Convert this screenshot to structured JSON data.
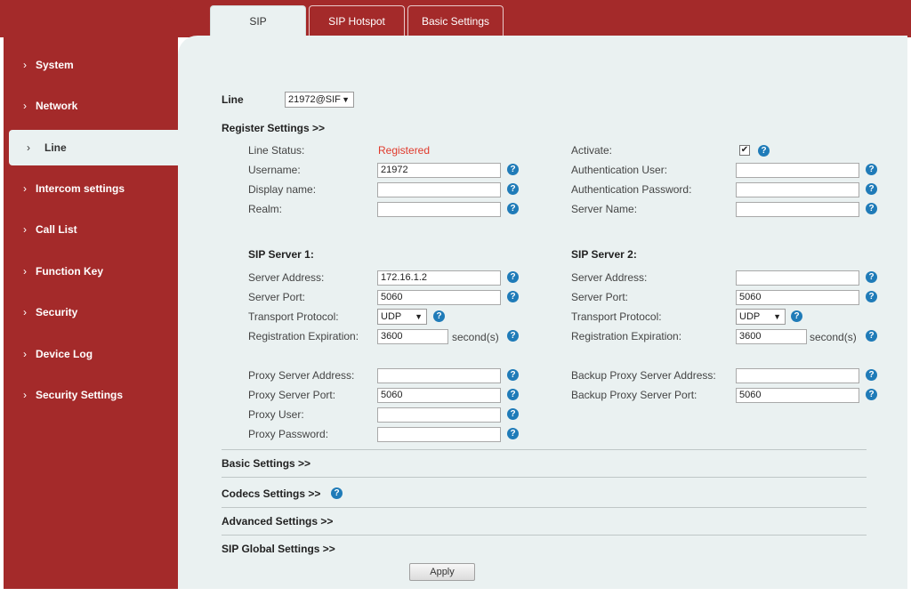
{
  "sidebar": {
    "items": [
      {
        "label": "System"
      },
      {
        "label": "Network"
      },
      {
        "label": "Line"
      },
      {
        "label": "Intercom settings"
      },
      {
        "label": "Call List"
      },
      {
        "label": "Function Key"
      },
      {
        "label": "Security"
      },
      {
        "label": "Device Log"
      },
      {
        "label": "Security Settings"
      }
    ],
    "active": "Line",
    "chevron": "›"
  },
  "tabs": [
    {
      "label": "SIP",
      "active": true
    },
    {
      "label": "SIP Hotspot",
      "active": false
    },
    {
      "label": "Basic Settings",
      "active": false
    }
  ],
  "line_selector": {
    "label": "Line",
    "value": "21972@SIF"
  },
  "sections": {
    "register": "Register Settings >>",
    "basic": "Basic Settings >>",
    "codecs": "Codecs Settings >>",
    "advanced": "Advanced Settings >>",
    "sip_global": "SIP Global Settings >>"
  },
  "register": {
    "line_status_label": "Line Status:",
    "line_status_value": "Registered",
    "activate_label": "Activate:",
    "activate_checked": "✔",
    "username_label": "Username:",
    "username_value": "21972",
    "auth_user_label": "Authentication User:",
    "auth_user_value": "",
    "display_name_label": "Display name:",
    "display_name_value": "",
    "auth_password_label": "Authentication Password:",
    "auth_password_value": "",
    "realm_label": "Realm:",
    "realm_value": "",
    "server_name_label": "Server Name:",
    "server_name_value": ""
  },
  "sip_server_1": {
    "title": "SIP Server 1:",
    "address_label": "Server Address:",
    "address_value": "172.16.1.2",
    "port_label": "Server Port:",
    "port_value": "5060",
    "transport_label": "Transport Protocol:",
    "transport_value": "UDP",
    "expiration_label": "Registration Expiration:",
    "expiration_value": "3600",
    "expiration_unit": "second(s)"
  },
  "sip_server_2": {
    "title": "SIP Server 2:",
    "address_label": "Server Address:",
    "address_value": "",
    "port_label": "Server Port:",
    "port_value": "5060",
    "transport_label": "Transport Protocol:",
    "transport_value": "UDP",
    "expiration_label": "Registration Expiration:",
    "expiration_value": "3600",
    "expiration_unit": "second(s)"
  },
  "proxy": {
    "address_label": "Proxy Server Address:",
    "address_value": "",
    "port_label": "Proxy Server Port:",
    "port_value": "5060",
    "user_label": "Proxy User:",
    "user_value": "",
    "password_label": "Proxy Password:",
    "password_value": "",
    "backup_address_label": "Backup Proxy Server Address:",
    "backup_address_value": "",
    "backup_port_label": "Backup Proxy Server Port:",
    "backup_port_value": "5060"
  },
  "apply_label": "Apply",
  "help_glyph": "?",
  "dropdown_arrow": "▼",
  "colors": {
    "brand_red": "#a42a2a",
    "content_bg": "#eaf1f1",
    "help_blue": "#1f7bb8",
    "status_red": "#e0392b"
  }
}
